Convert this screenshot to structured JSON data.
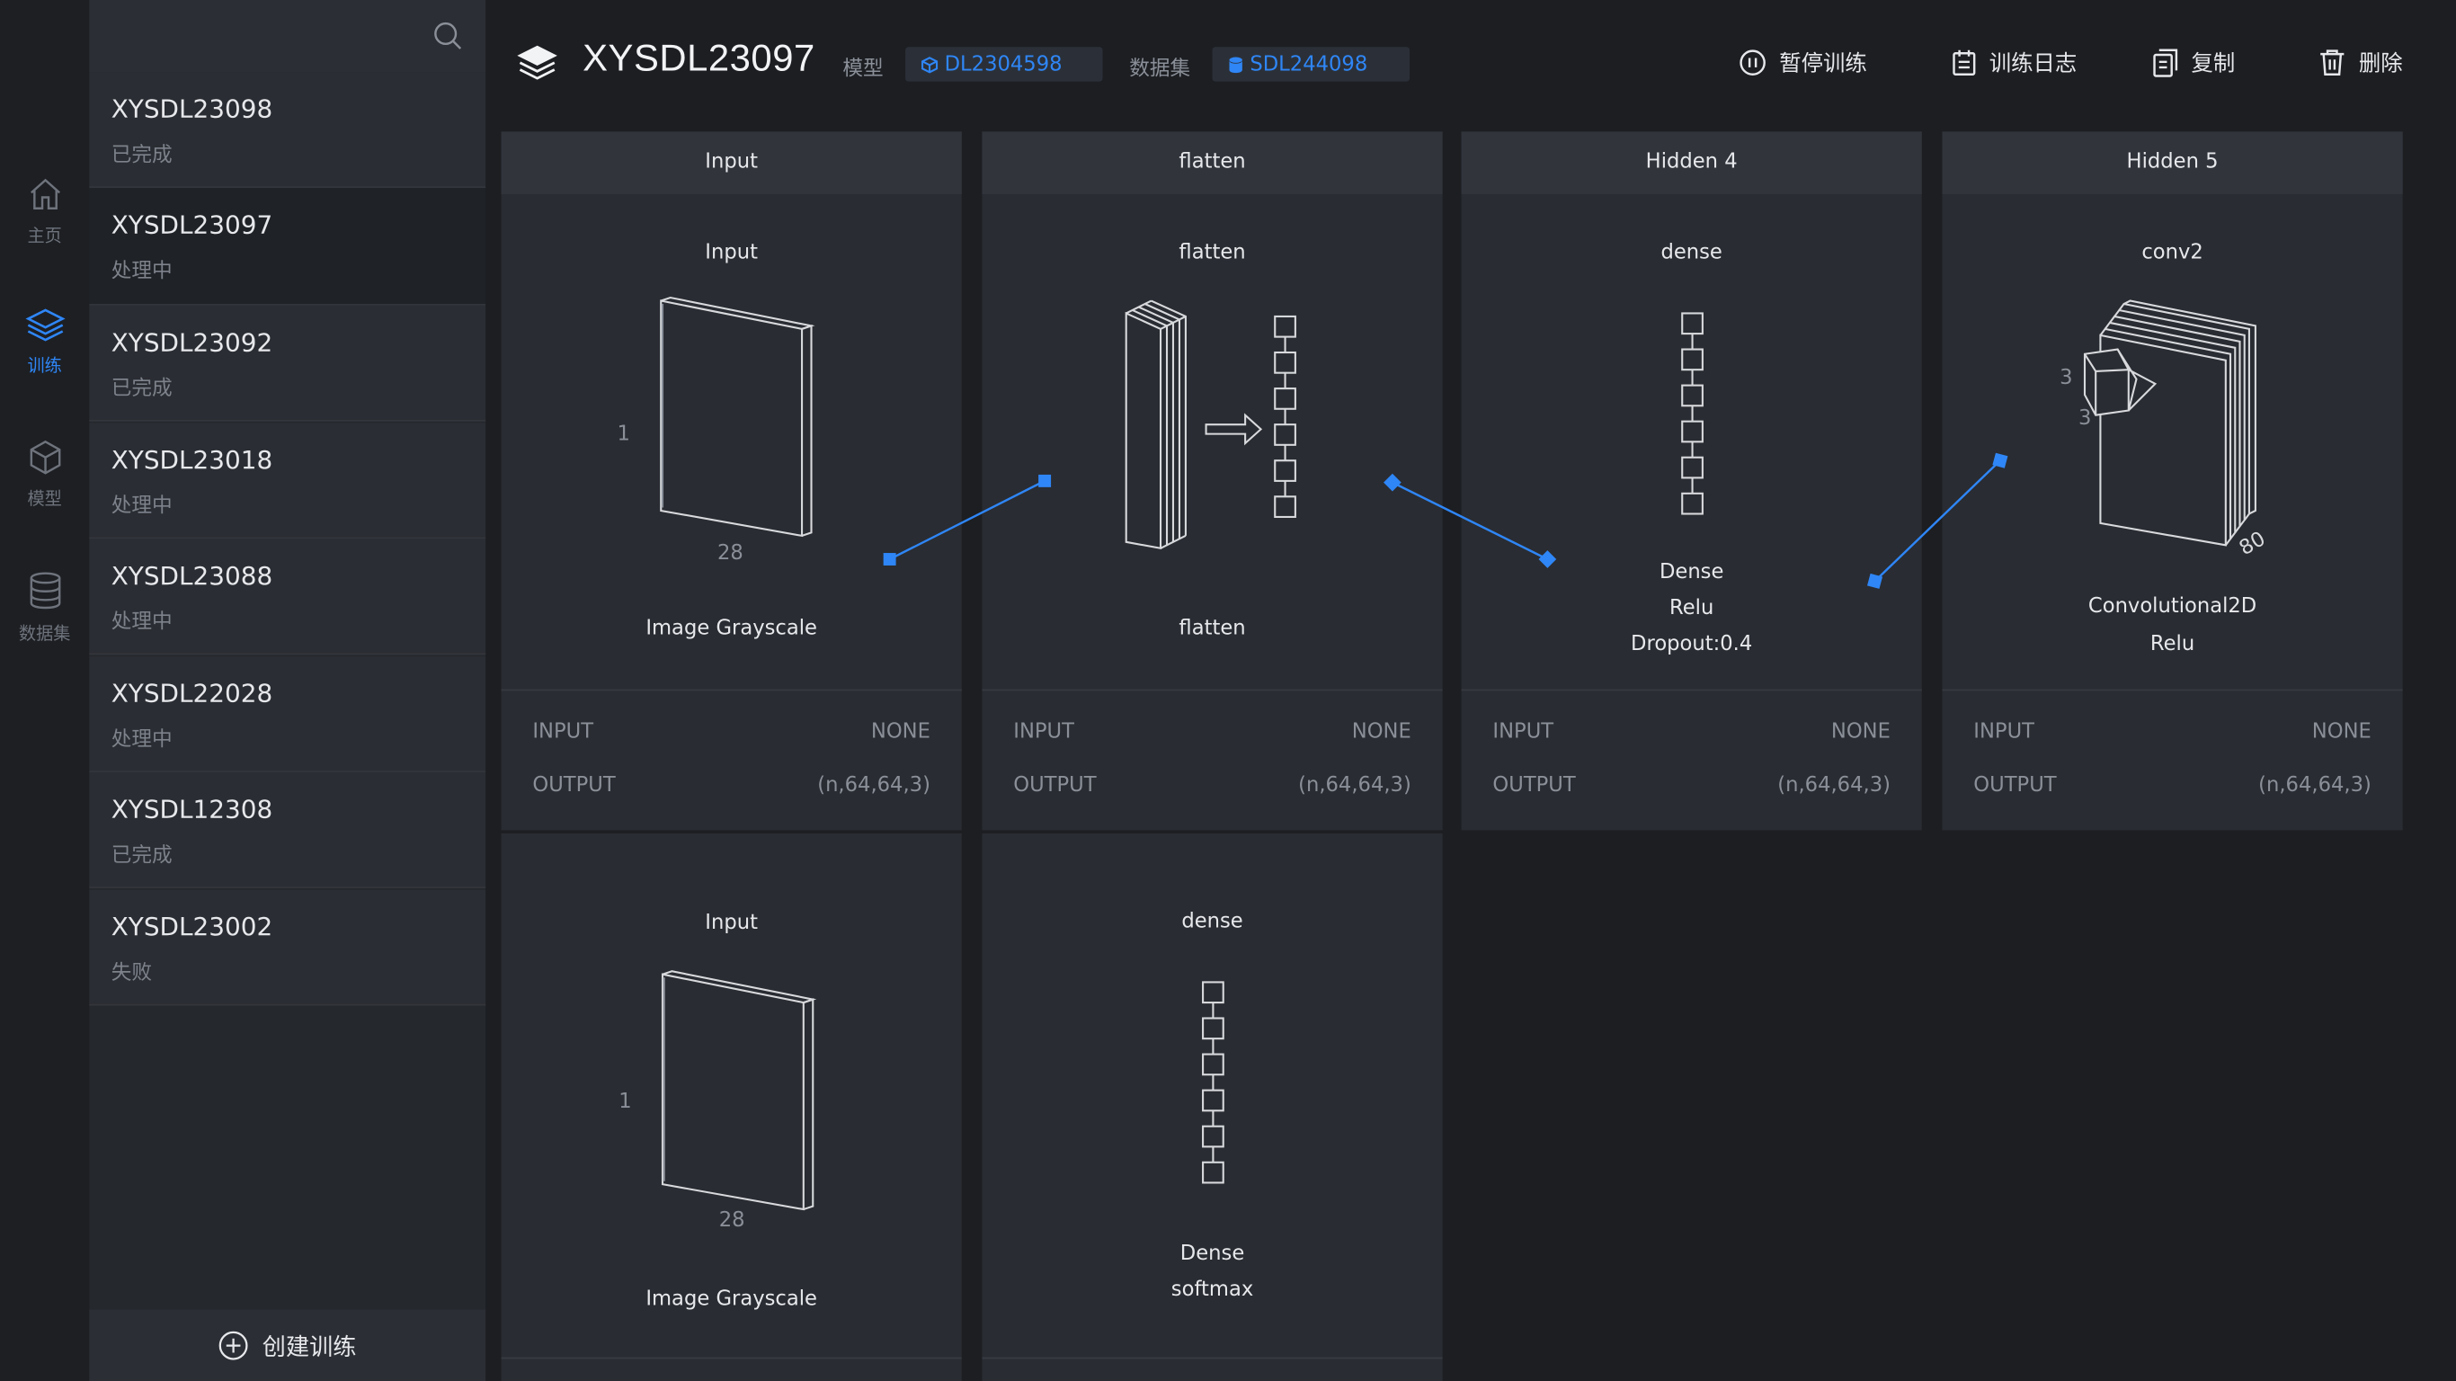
{
  "nav": [
    {
      "label": "主页",
      "icon": "home-icon"
    },
    {
      "label": "训练",
      "icon": "layers-icon",
      "active": true
    },
    {
      "label": "模型",
      "icon": "cube-icon"
    },
    {
      "label": "数据集",
      "icon": "database-icon"
    }
  ],
  "trainings": [
    {
      "name": "XYSDL23098",
      "status": "已完成"
    },
    {
      "name": "XYSDL23097",
      "status": "处理中",
      "active": true
    },
    {
      "name": "XYSDL23092",
      "status": "已完成"
    },
    {
      "name": "XYSDL23018",
      "status": "处理中"
    },
    {
      "name": "XYSDL23088",
      "status": "处理中"
    },
    {
      "name": "XYSDL22028",
      "status": "处理中"
    },
    {
      "name": "XYSDL12308",
      "status": "已完成"
    },
    {
      "name": "XYSDL23002",
      "status": "失败"
    }
  ],
  "create_label": "创建训练",
  "header": {
    "title": "XYSDL23097",
    "model_label": "模型",
    "model_value": "DL2304598",
    "dataset_label": "数据集",
    "dataset_value": "SDL244098",
    "actions": {
      "pause": "暂停训练",
      "log": "训练日志",
      "copy": "复制",
      "delete": "删除"
    }
  },
  "layers": [
    {
      "head": "Input",
      "sub": "Input",
      "dim_side": "1",
      "dim_bottom": "28",
      "desc": "Image  Grayscale",
      "input_label": "INPUT",
      "input_value": "NONE",
      "output_label": "OUTPUT",
      "output_value": "(n,64,64,3)"
    },
    {
      "head": "flatten",
      "sub": "flatten",
      "desc": "flatten",
      "input_label": "INPUT",
      "input_value": "NONE",
      "output_label": "OUTPUT",
      "output_value": "(n,64,64,3)"
    },
    {
      "head": "Hidden 4",
      "sub": "dense",
      "desc1": "Dense",
      "desc2": "Relu",
      "desc3": "Dropout:0.4",
      "input_label": "INPUT",
      "input_value": "NONE",
      "output_label": "OUTPUT",
      "output_value": "(n,64,64,3)"
    },
    {
      "head": "Hidden 5",
      "sub": "conv2",
      "dim_a": "3",
      "dim_b": "3",
      "dim_c": "80",
      "desc1": "Convolutional2D",
      "desc2": "Relu",
      "input_label": "INPUT",
      "input_value": "NONE",
      "output_label": "OUTPUT",
      "output_value": "(n,64,64,3)"
    }
  ],
  "layers2": [
    {
      "sub": "Input",
      "dim_side": "1",
      "dim_bottom": "28",
      "desc": "Image  Grayscale"
    },
    {
      "sub": "dense",
      "desc1": "Dense",
      "desc2": "softmax"
    }
  ],
  "colors": {
    "accent": "#2f86f6",
    "bg": "#1c1e22",
    "card": "#292c32",
    "card_head": "#31343b"
  }
}
